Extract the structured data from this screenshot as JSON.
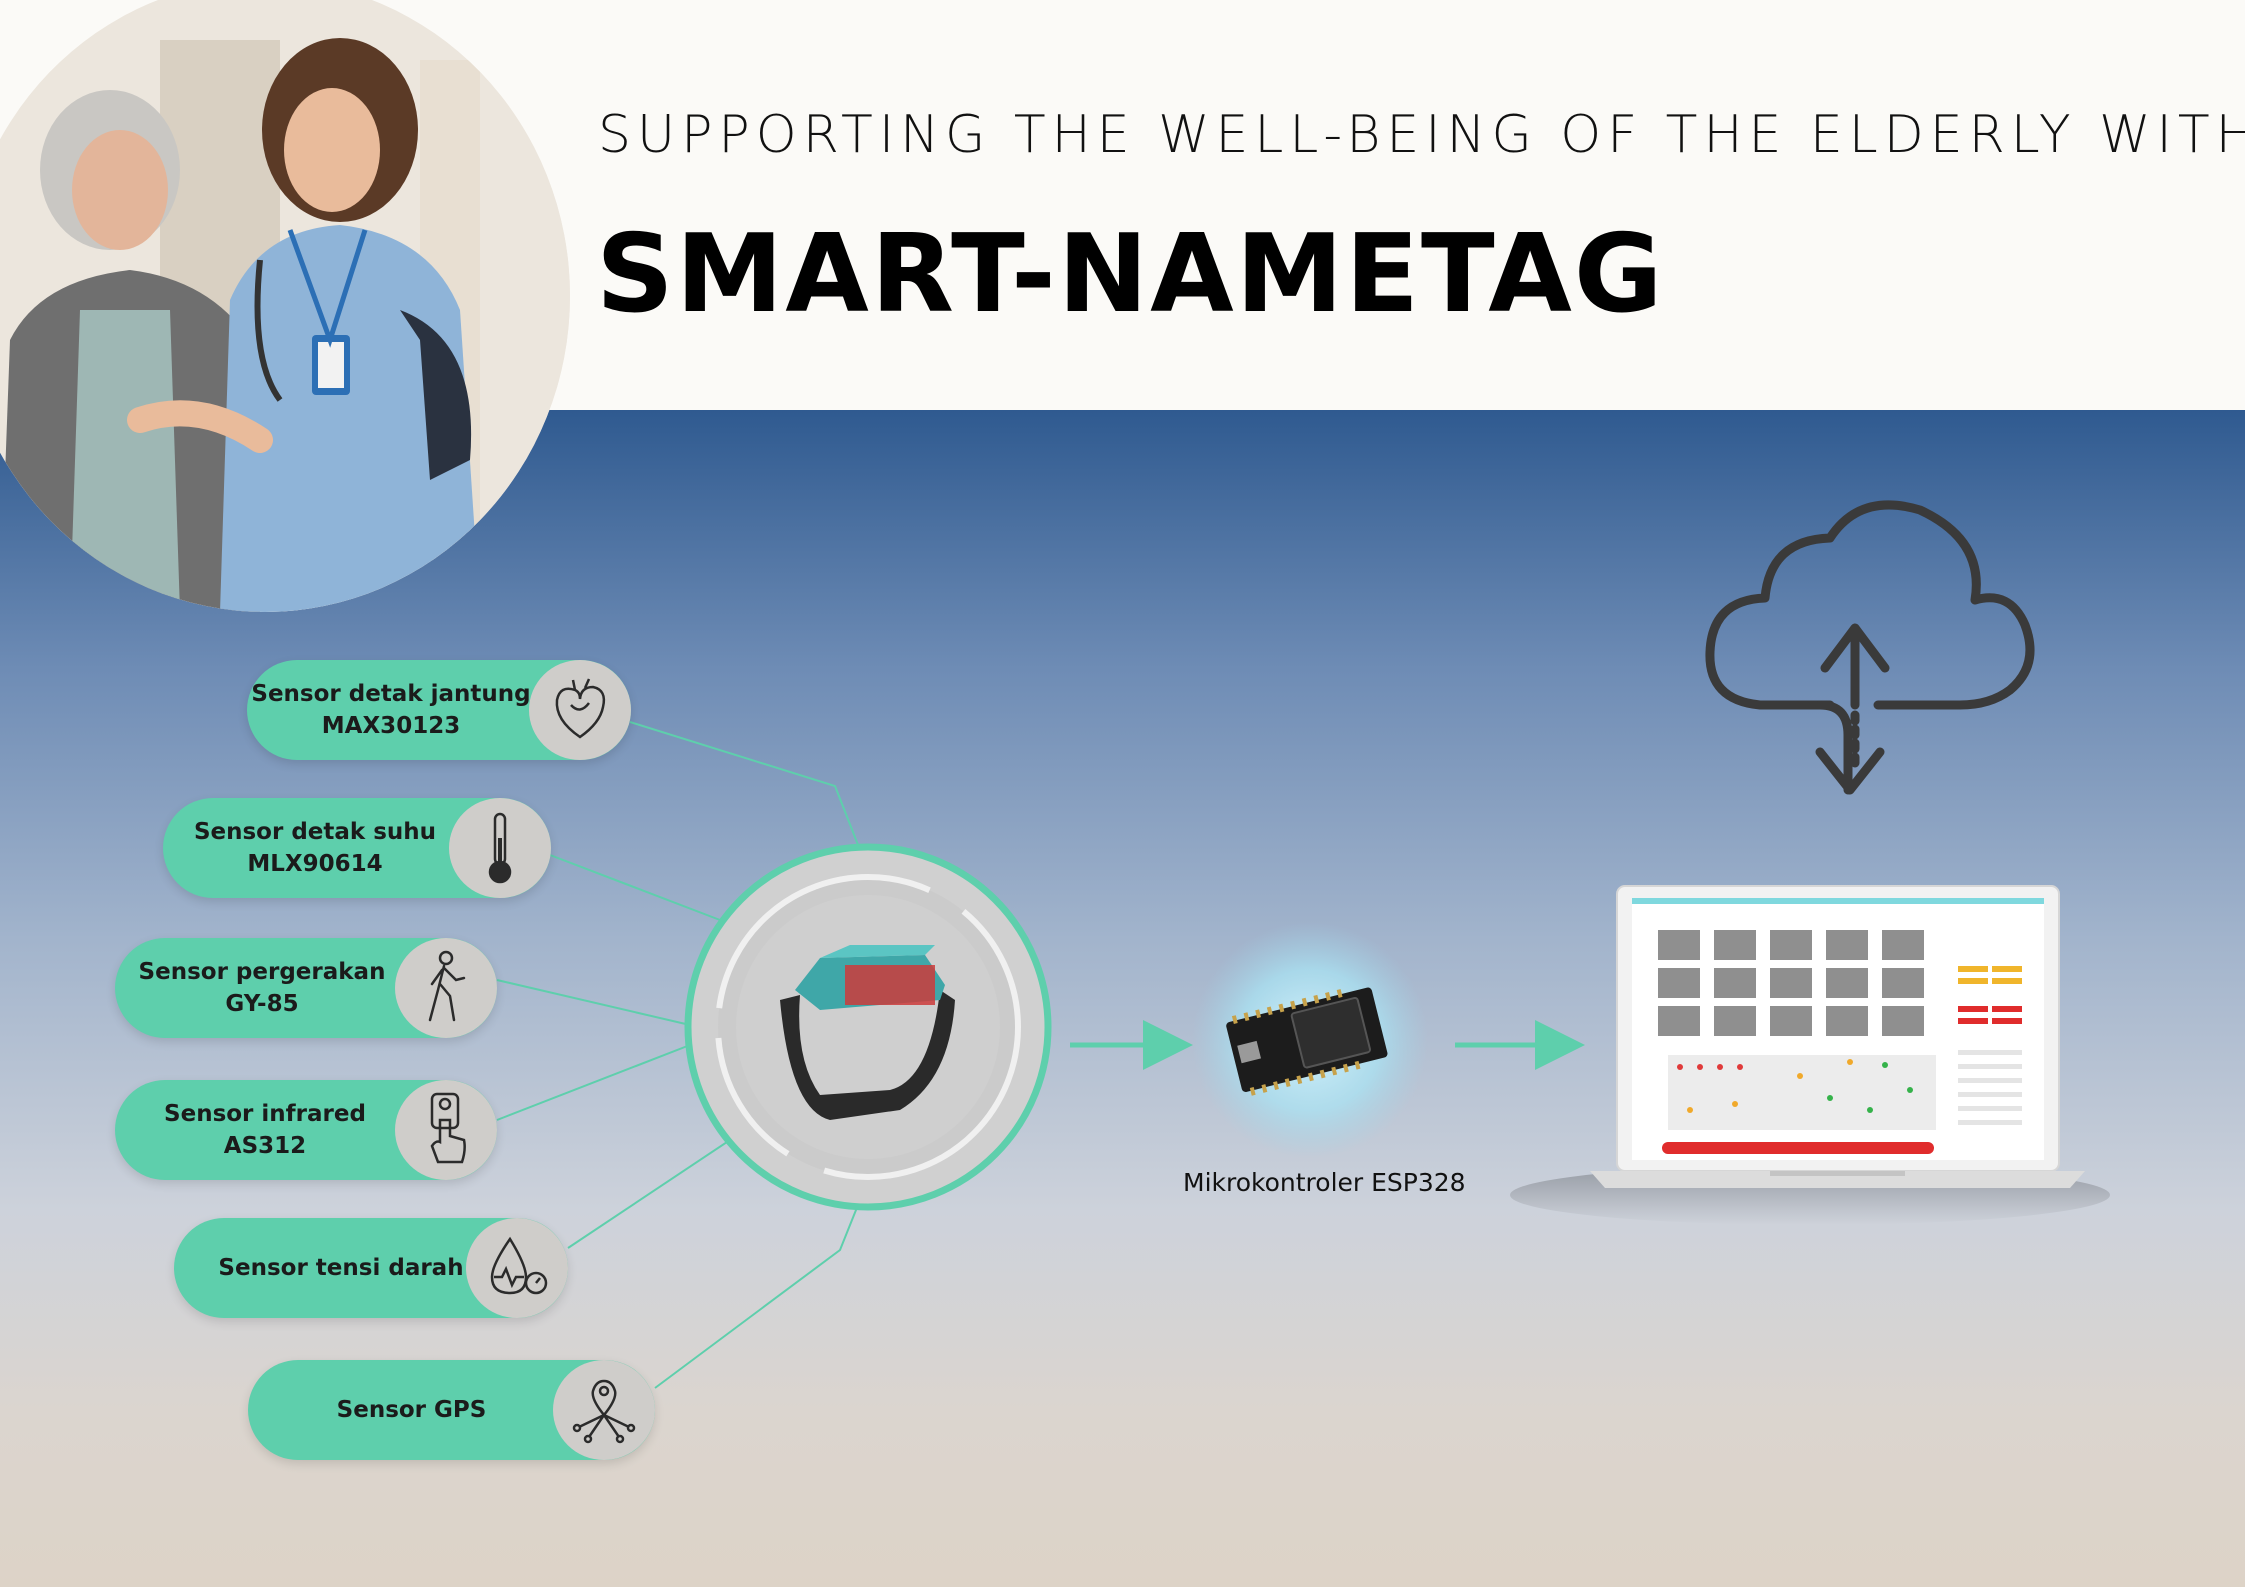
{
  "header": {
    "subtitle": "SUPPORTING THE WELL-BEING OF THE ELDERLY WITH",
    "title": "SMART-NAMETAG"
  },
  "sensors": [
    {
      "label": "Sensor detak jantung\nMAX30123",
      "icon": "heart-icon"
    },
    {
      "label": "Sensor detak suhu\nMLX90614",
      "icon": "thermometer-icon"
    },
    {
      "label": "Sensor pergerakan\nGY-85",
      "icon": "walking-person-icon"
    },
    {
      "label": "Sensor infrared\nAS312",
      "icon": "hand-device-icon"
    },
    {
      "label": "Sensor tensi darah",
      "icon": "blood-pressure-icon"
    },
    {
      "label": "Sensor GPS",
      "icon": "gps-pin-icon"
    }
  ],
  "device": {
    "icon": "smart-nametag-device"
  },
  "microcontroller": {
    "label": "Mikrokontroler ESP328",
    "icon": "esp32-board"
  },
  "cloud": {
    "icon": "cloud-upload-download-icon"
  },
  "dashboard": {
    "icon": "laptop-dashboard"
  },
  "colors": {
    "accent": "#5ecfac",
    "title": "#000000",
    "top_band": "#fbfaf7",
    "band_top": "#2f5a90"
  }
}
